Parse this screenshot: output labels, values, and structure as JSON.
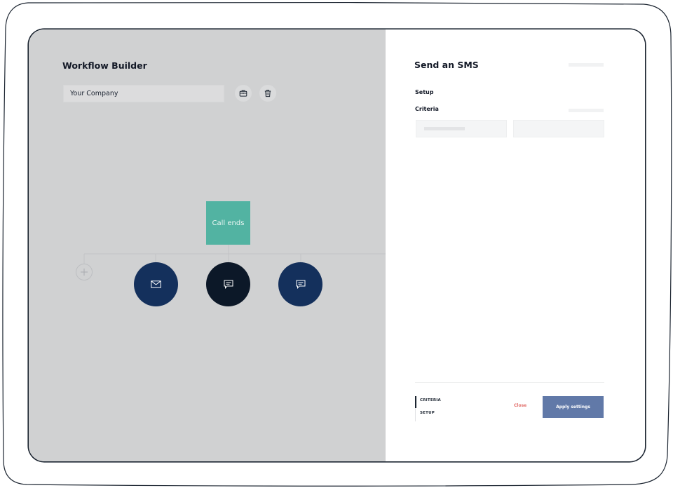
{
  "builder": {
    "title": "Workflow Builder",
    "company_input_value": "Your Company",
    "toolbar_icons": [
      "briefcase-icon",
      "trash-icon"
    ]
  },
  "workflow": {
    "trigger_label": "Call ends",
    "nodes": [
      {
        "icon": "mail-icon",
        "color": "#14305c"
      },
      {
        "icon": "chat-icon",
        "color": "#0c1828"
      },
      {
        "icon": "chat-icon",
        "color": "#14305c"
      }
    ],
    "add_icon": "plus-icon"
  },
  "panel": {
    "title": "Send an SMS",
    "setup_label": "Setup",
    "criteria_label": "Criteria",
    "tabs": [
      "CRITERIA",
      "SETUP"
    ],
    "close_label": "Close",
    "apply_label": "Apply settings"
  },
  "colors": {
    "canvas_bg": "#d0d1d2",
    "trigger": "#52b3a2",
    "node_navy": "#14305c",
    "node_dark": "#0c1828",
    "apply": "#6179a8",
    "close": "#e2706c"
  }
}
